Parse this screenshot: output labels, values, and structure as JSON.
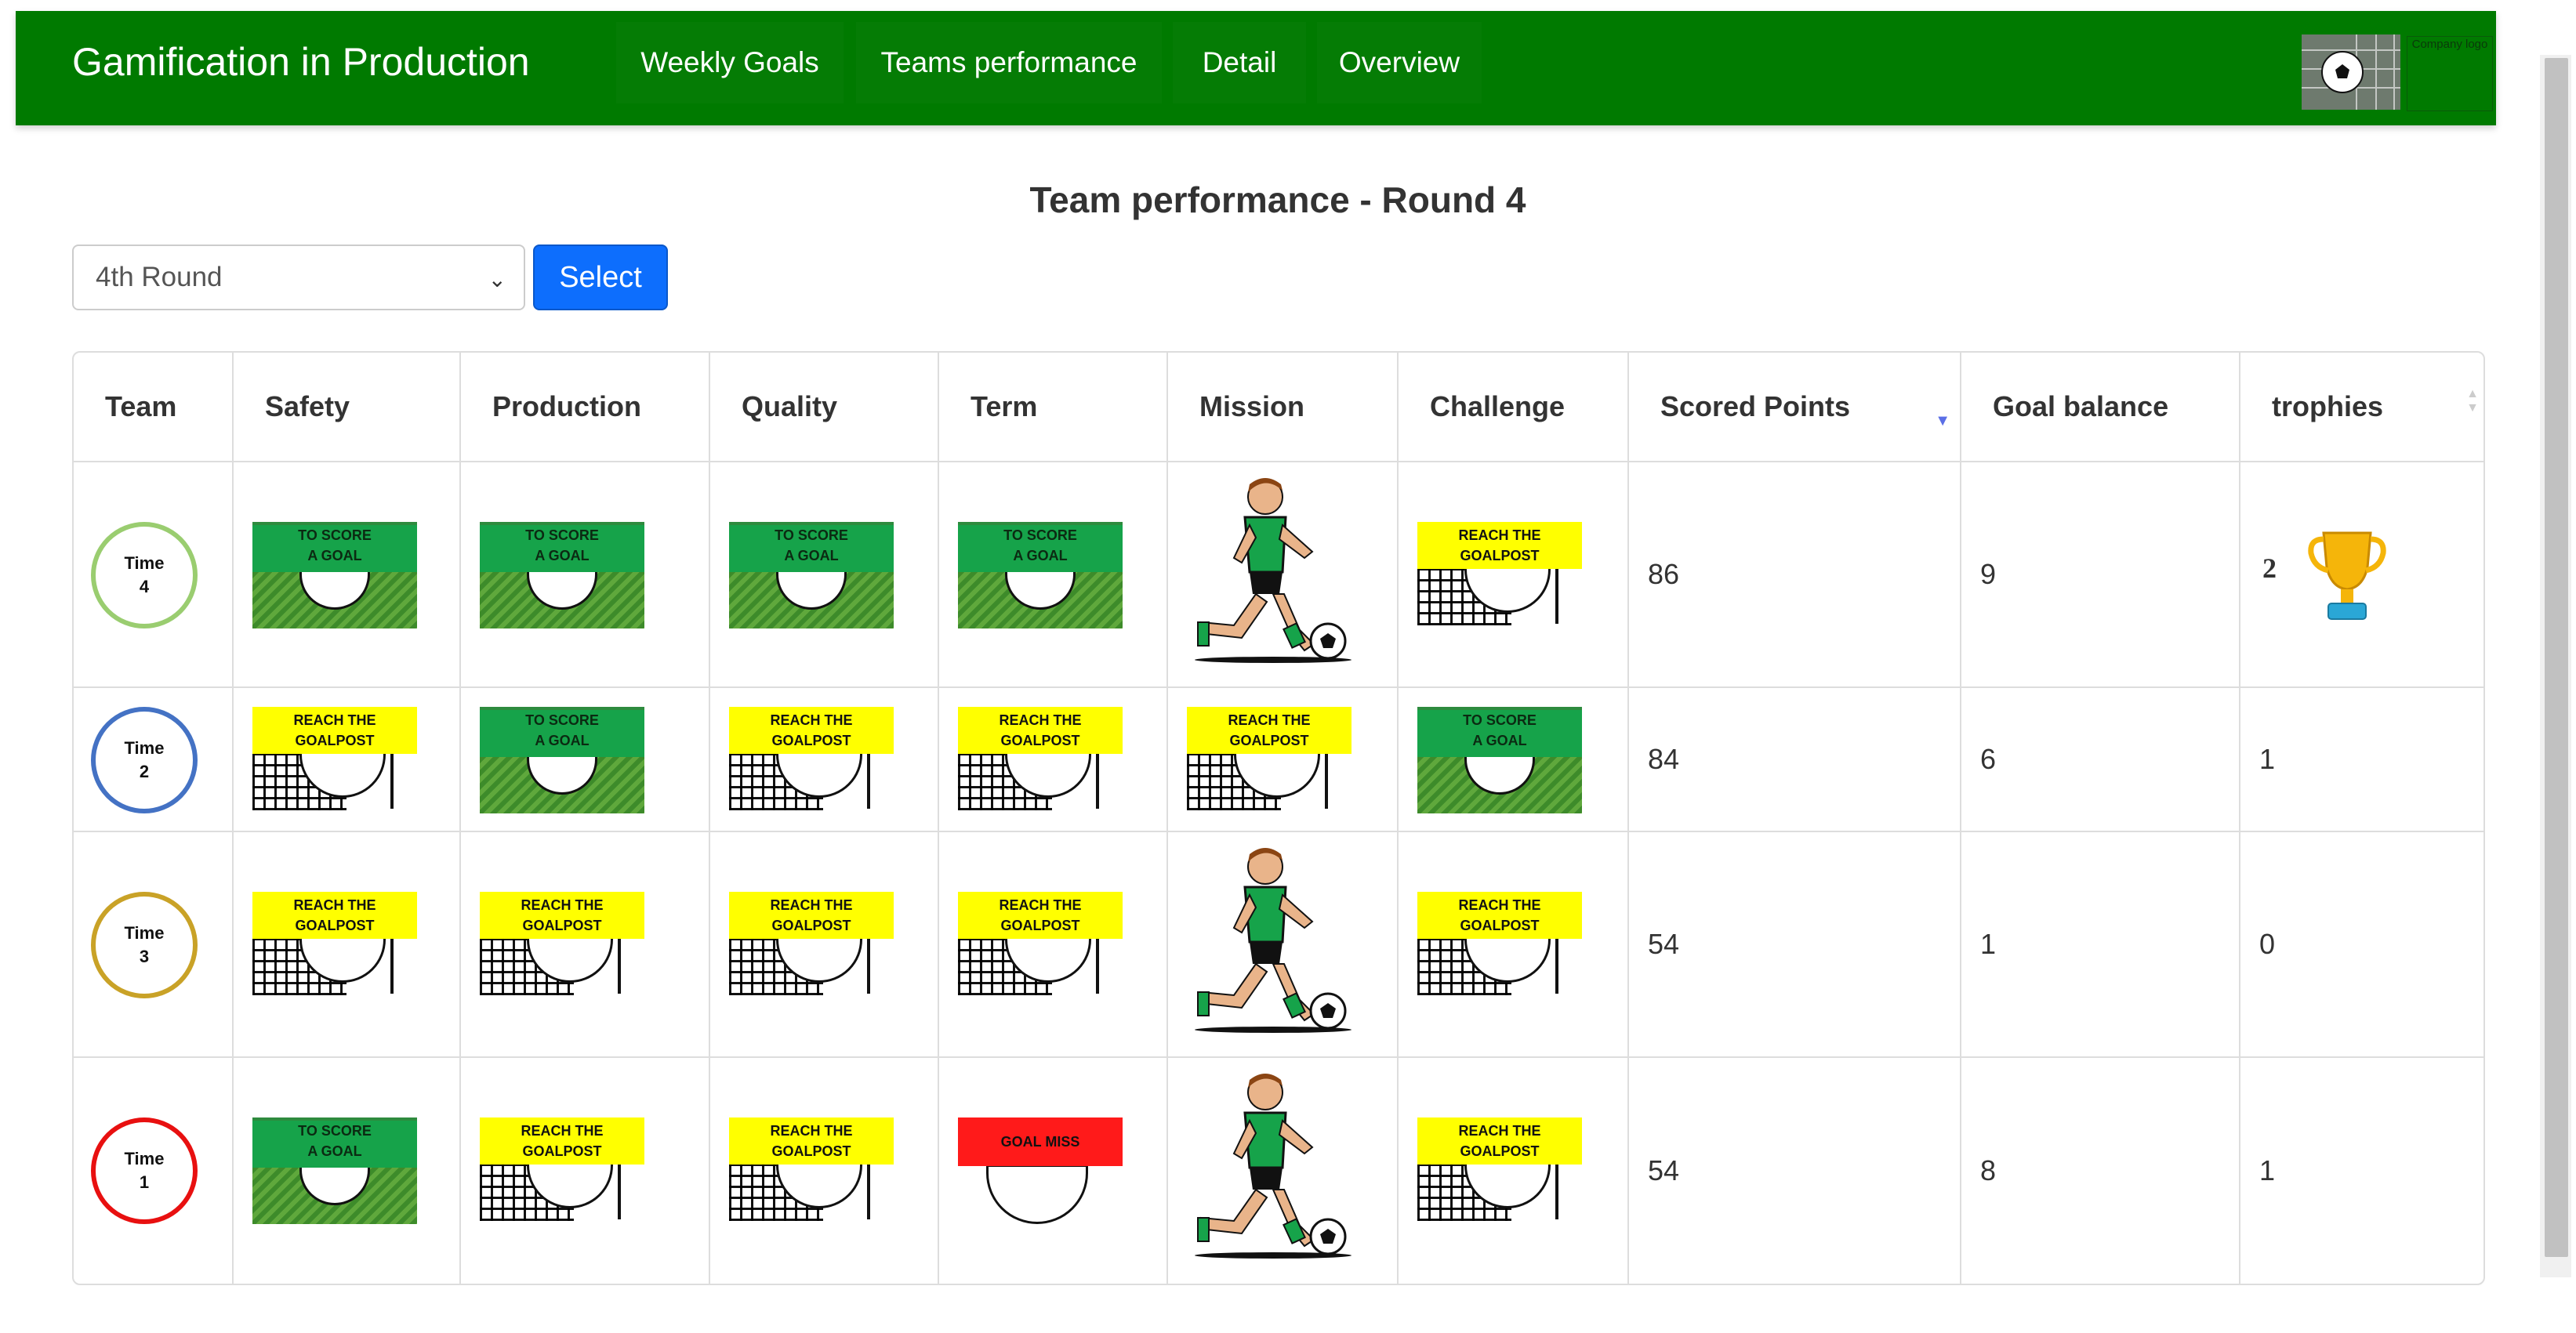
{
  "app": {
    "brand": "Gamification in Production",
    "logo_text": "Company logo"
  },
  "nav": {
    "items": [
      "Weekly Goals",
      "Teams performance",
      "Detail",
      "Overview"
    ]
  },
  "page": {
    "title": "Team performance - Round 4"
  },
  "filter": {
    "selected": "4th Round",
    "button": "Select"
  },
  "badges": {
    "score": [
      "TO SCORE",
      "A GOAL"
    ],
    "post": [
      "REACH THE",
      "GOALPOST"
    ],
    "miss": "GOAL MISS"
  },
  "table": {
    "headers": [
      "Team",
      "Safety",
      "Production",
      "Quality",
      "Term",
      "Mission",
      "Challenge",
      "Scored Points",
      "Goal balance",
      "trophies"
    ],
    "sorted_column": "Scored Points",
    "sort_direction": "descending",
    "rows": [
      {
        "team": [
          "Time",
          "4"
        ],
        "team_color": "#9acd70",
        "safety": "score",
        "production": "score",
        "quality": "score",
        "term": "score",
        "mission": "player",
        "challenge": "post",
        "scored_points": "86",
        "goal_balance": "9",
        "trophies": "2",
        "trophy_icon": true
      },
      {
        "team": [
          "Time",
          "2"
        ],
        "team_color": "#4472c4",
        "safety": "post",
        "production": "score",
        "quality": "post",
        "term": "post",
        "mission": "post",
        "challenge": "score",
        "scored_points": "84",
        "goal_balance": "6",
        "trophies": "1",
        "trophy_icon": false
      },
      {
        "team": [
          "Time",
          "3"
        ],
        "team_color": "#c9a227",
        "safety": "post",
        "production": "post",
        "quality": "post",
        "term": "post",
        "mission": "player",
        "challenge": "post",
        "scored_points": "54",
        "goal_balance": "1",
        "trophies": "0",
        "trophy_icon": false
      },
      {
        "team": [
          "Time",
          "1"
        ],
        "team_color": "#e81010",
        "safety": "score",
        "production": "post",
        "quality": "post",
        "term": "miss",
        "mission": "player",
        "challenge": "post",
        "scored_points": "54",
        "goal_balance": "8",
        "trophies": "1",
        "trophy_icon": false
      }
    ]
  },
  "colors": {
    "navbar": "#007a00",
    "primary_button": "#0d6efd",
    "score_badge": "#16a34a",
    "post_badge": "#ffff00",
    "miss_badge": "#ff1a1a",
    "sort_arrow": "#5b6fe6"
  },
  "icons": [
    "soccer-ball-icon",
    "chevron-down-icon",
    "sort-desc-icon",
    "sort-both-icon",
    "trophy-icon",
    "soccer-player-icon"
  ]
}
